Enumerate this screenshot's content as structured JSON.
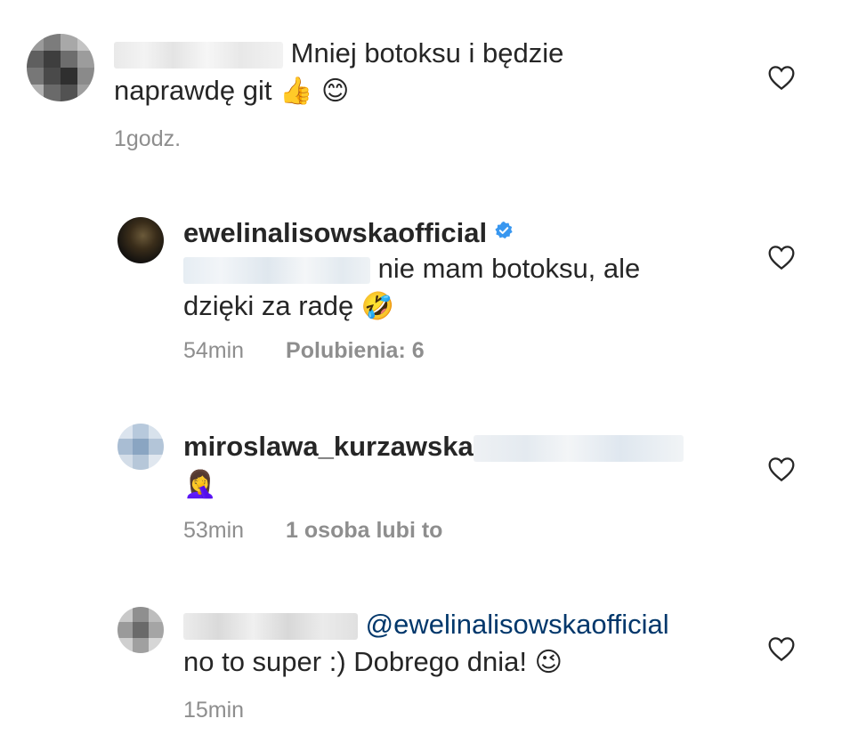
{
  "comments": [
    {
      "text": "Mniej botoksu i będzie",
      "text2": "naprawdę git",
      "emoji": "👍 😊",
      "time": "1godz."
    },
    {
      "username": "ewelinalisowskaofficial",
      "text": "nie mam botoksu, ale",
      "text2": "dzięki za radę",
      "emoji": "🤣",
      "time": "54min",
      "likes": "Polubienia: 6"
    },
    {
      "username": "miroslawa_kurzawska",
      "emoji": "🤦‍♀️",
      "time": "53min",
      "likes": "1 osoba lubi to"
    },
    {
      "mention": "@ewelinalisowskaofficial",
      "text2": "no to super :) Dobrego dnia!",
      "emoji": "😉",
      "time": "15min"
    }
  ],
  "colors": {
    "text": "#262626",
    "meta": "#8e8e8e",
    "mention": "#00376b",
    "verified": "#3897f0"
  },
  "icons": {
    "like": "heart-outline-icon",
    "verified": "verified-badge-icon"
  }
}
